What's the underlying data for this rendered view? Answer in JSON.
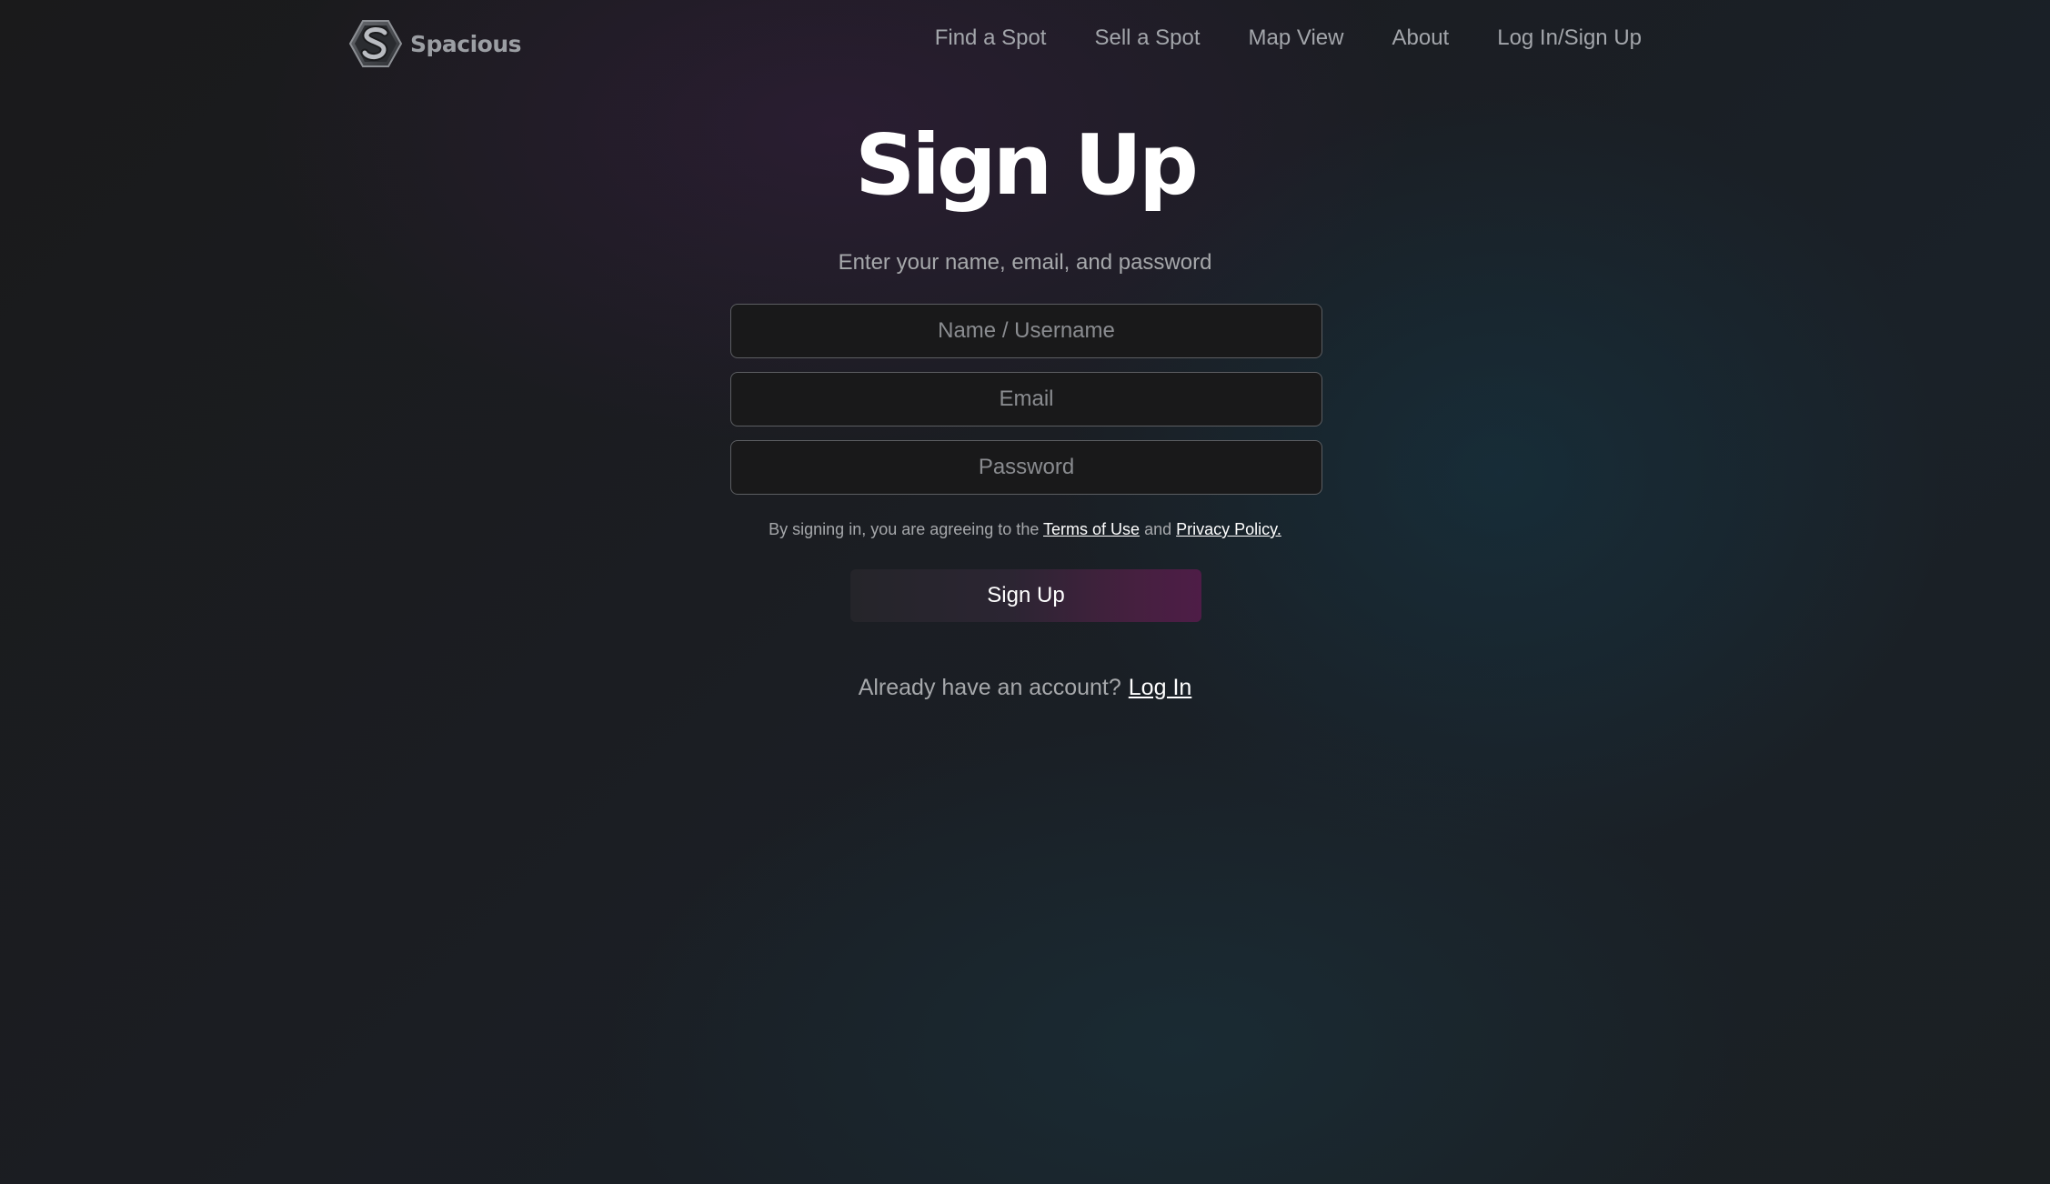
{
  "header": {
    "brand_name": "Spacious",
    "logo_icon": "hexagon-s-logo-icon",
    "nav": {
      "find_spot": "Find a Spot",
      "sell_spot": "Sell a Spot",
      "map_view": "Map View",
      "about": "About",
      "login_signup": "Log In/Sign Up"
    }
  },
  "form": {
    "title": "Sign Up",
    "subtitle": "Enter your name, email, and password",
    "name_placeholder": "Name / Username",
    "email_placeholder": "Email",
    "password_placeholder": "Password",
    "terms_prefix": "By signing in, you are agreeing to the",
    "terms_link": "Terms of Use",
    "terms_and": "and",
    "privacy_link": "Privacy Policy.",
    "submit_label": "Sign Up",
    "already_text": "Already have an account?",
    "login_link": "Log In"
  },
  "colors": {
    "accent_purple": "#4e1d47",
    "muted_text": "#a6a8ab",
    "field_border": "#5c5e62"
  }
}
